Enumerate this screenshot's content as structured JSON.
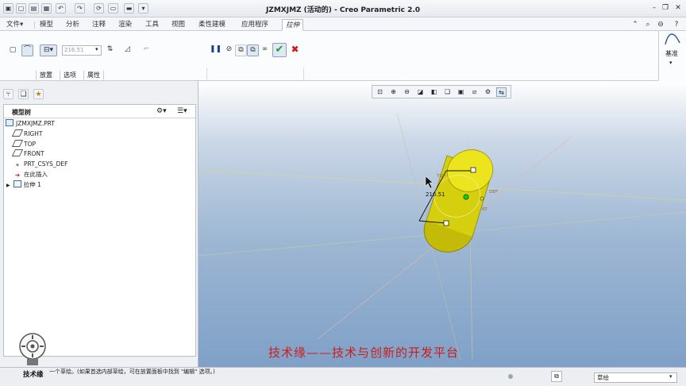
{
  "window": {
    "title": "JZMXJMZ (活动的) - Creo Parametric 2.0"
  },
  "tabs": [
    "文件▾",
    "模型",
    "分析",
    "注释",
    "渲染",
    "工具",
    "视图",
    "柔性建模",
    "应用程序",
    "拉伸"
  ],
  "ribbon": {
    "depth_value": "216.51",
    "subtabs": [
      "放置",
      "选项",
      "属性"
    ],
    "datum_label": "基准"
  },
  "side": {
    "tree_label": "模型树"
  },
  "tree": [
    {
      "label": "JZMXJMZ.PRT"
    },
    {
      "label": "RIGHT"
    },
    {
      "label": "TOP"
    },
    {
      "label": "FRONT"
    },
    {
      "label": "PRT_CSYS_DEF"
    },
    {
      "label": "在此插入"
    },
    {
      "label": "拉伸 1"
    }
  ],
  "viewport": {
    "dim_value": "216.51",
    "plane_labels": [
      "TOP",
      "DEF",
      "RT"
    ]
  },
  "overlay": {
    "watermark": "技术缘——技术与创新的开发平台",
    "logo_text": "技术缘"
  },
  "status": {
    "message": "一个草绘。(如果首选内部草绘，可在放置面板中找到 \"编辑\" 选项。)",
    "filter": "草绘"
  },
  "colors": {
    "accent_green": "#1e9e2e",
    "cancel_red": "#d11919",
    "model_yellow": "#d8d010",
    "watermark_red": "#cc1c1c"
  }
}
